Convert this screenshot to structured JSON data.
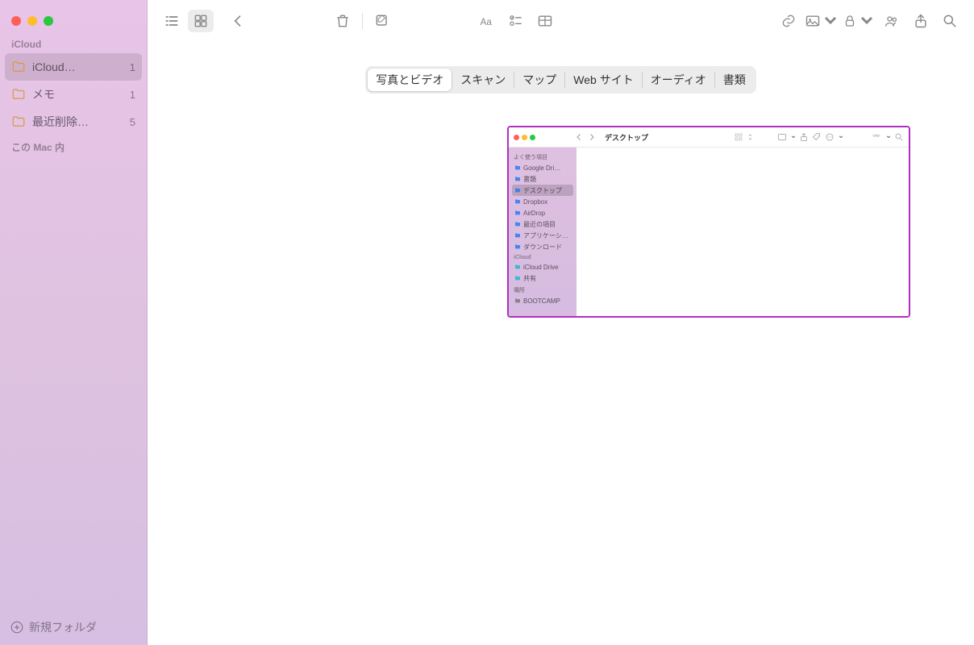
{
  "sidebar": {
    "sections": [
      {
        "label": "iCloud",
        "items": [
          {
            "id": "icloud-all",
            "label": "iCloud…",
            "count": "1",
            "selected": true
          },
          {
            "id": "memo",
            "label": "メモ",
            "count": "1",
            "selected": false
          },
          {
            "id": "trash",
            "label": "最近削除…",
            "count": "5",
            "selected": false
          }
        ]
      },
      {
        "label": "この Mac 内",
        "items": []
      }
    ],
    "footer": "新規フォルダ"
  },
  "toolbar": {
    "icons": [
      "list",
      "grid",
      "back",
      "trash",
      "compose",
      "font",
      "checklist",
      "table",
      "link",
      "media",
      "lock",
      "collab",
      "share",
      "search"
    ]
  },
  "segments": [
    "写真とビデオ",
    "スキャン",
    "マップ",
    "Web サイト",
    "オーディオ",
    "書類"
  ],
  "segment_selected": 0,
  "attachment": {
    "title": "デスクトップ",
    "sections": [
      {
        "label": "よく使う項目",
        "items": [
          {
            "label": "Google Dri…",
            "color": "c-blue"
          },
          {
            "label": "書類",
            "color": "c-blue"
          },
          {
            "label": "デスクトップ",
            "color": "c-blue",
            "selected": true
          },
          {
            "label": "Dropbox",
            "color": "c-blue"
          },
          {
            "label": "AirDrop",
            "color": "c-blue"
          },
          {
            "label": "最近の項目",
            "color": "c-blue"
          },
          {
            "label": "アプリケーション",
            "color": "c-blue"
          },
          {
            "label": "ダウンロード",
            "color": "c-blue"
          }
        ]
      },
      {
        "label": "iCloud",
        "items": [
          {
            "label": "iCloud Drive",
            "color": "c-teal"
          },
          {
            "label": "共有",
            "color": "c-teal"
          }
        ]
      },
      {
        "label": "場所",
        "items": [
          {
            "label": "BOOTCAMP",
            "color": "c-gray"
          }
        ]
      }
    ]
  }
}
